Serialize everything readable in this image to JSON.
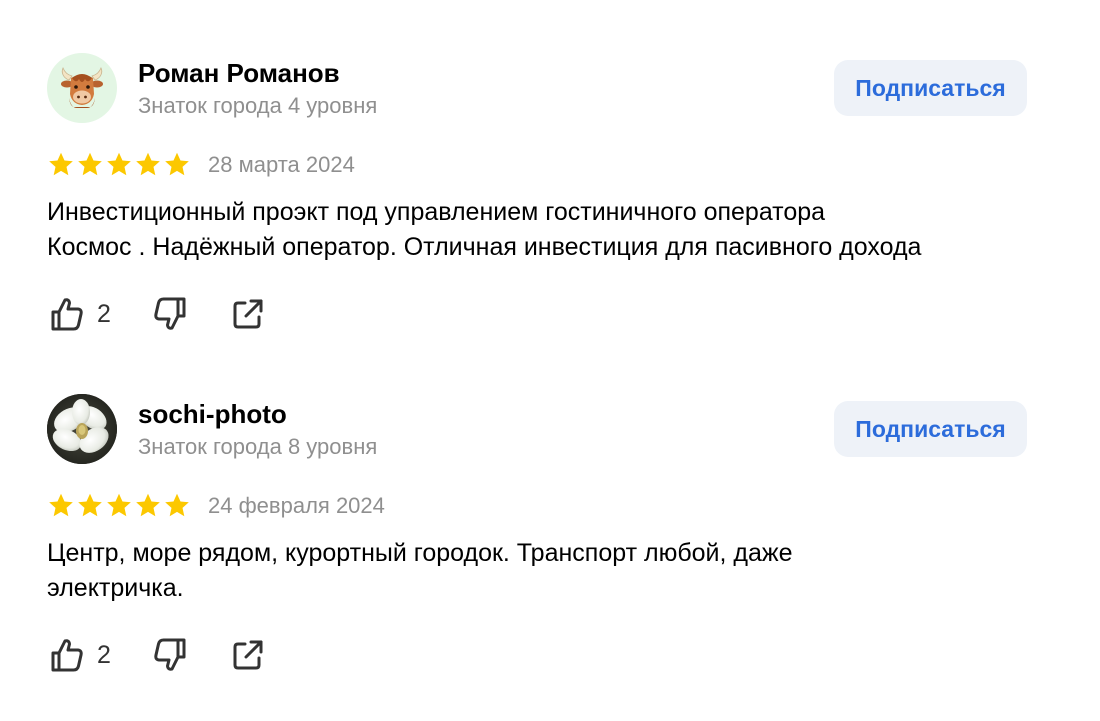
{
  "reviews": [
    {
      "author_name": "Роман Романов",
      "author_level": "Знаток города 4 уровня",
      "subscribe_label": "Подписаться",
      "rating": 5,
      "date": "28 марта 2024",
      "text": "Инвестиционный проэкт под управлением гостиничного оператора\nКосмос . Надёжный оператор. Отличная инвестиция для пасивного дохода",
      "likes": "2",
      "avatar_icon": "yak-emoji-icon"
    },
    {
      "author_name": "sochi-photo",
      "author_level": "Знаток города 8 уровня",
      "subscribe_label": "Подписаться",
      "rating": 5,
      "date": "24 февраля 2024",
      "text": "Центр, море рядом, курортный городок. Транспорт любой, даже\nэлектричка.",
      "likes": "2",
      "avatar_icon": "magnolia-photo"
    }
  ],
  "icons": {
    "like": "thumbs-up-icon",
    "dislike": "thumbs-down-icon",
    "share": "share-icon",
    "star": "star-icon"
  },
  "colors": {
    "star": "#fcc800",
    "subscribe_text": "#2c6cdb",
    "subscribe_bg": "#eef2f8",
    "secondary_text": "#8f8f8f",
    "avatar_bg": "#e3f6e4"
  }
}
